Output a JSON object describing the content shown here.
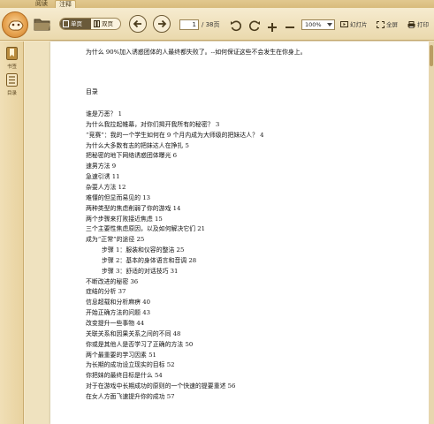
{
  "menu": {
    "tabs": [
      {
        "label": "阅读"
      },
      {
        "label": "注释"
      }
    ]
  },
  "toolbar": {
    "view_single": "单页",
    "view_double": "双页",
    "page_current": "1",
    "page_total": "/ 38页",
    "zoom": "100%",
    "slideshow": "幻灯片",
    "fullscreen": "全屏",
    "print": "打印"
  },
  "sidebar": {
    "items": [
      {
        "label": "书签"
      },
      {
        "label": "目录"
      }
    ]
  },
  "document": {
    "intro": "为什么 90%加入诱惑团体的人最终都失败了。--如何保证这些不会发生在你身上。",
    "toc_title": "目录",
    "toc": [
      {
        "text": "谁是万恶？   1",
        "indent": false
      },
      {
        "text": "为什么我拉起帷幕，对你们揭开我所有的秘密？   3",
        "indent": false
      },
      {
        "text": "“竞赛”：我的一个学生如何在 9 个月内成为大师级的把妹达人？   4",
        "indent": false
      },
      {
        "text": "为什么大多数有志的把妹达人在挣扎   5",
        "indent": false
      },
      {
        "text": "把秘密的地下网络诱惑团体曝光   6",
        "indent": false
      },
      {
        "text": "速男方法   9",
        "indent": false
      },
      {
        "text": "急速引诱   11",
        "indent": false
      },
      {
        "text": "杂耍人方法   12",
        "indent": false
      },
      {
        "text": "难懂的但显而易见的   13",
        "indent": false
      },
      {
        "text": "两种类型的焦虑削弱了你的游戏   14",
        "indent": false
      },
      {
        "text": "两个步骤来打败接近焦虑   15",
        "indent": false
      },
      {
        "text": "三个主要性焦虑原因，以及如何解决它们   21",
        "indent": false
      },
      {
        "text": "成为“正常”的途径   25",
        "indent": false
      },
      {
        "text": "步骤 1：服装和仪容的整洁   25",
        "indent": true
      },
      {
        "text": "步骤 2：基本的身体语言和音调   28",
        "indent": true
      },
      {
        "text": "步骤 3：舒适的对话技巧   31",
        "indent": true
      },
      {
        "text": "不断改进的秘密   36",
        "indent": false
      },
      {
        "text": "症结的分析   37",
        "indent": false
      },
      {
        "text": "信息超载和分析麻痹   40",
        "indent": false
      },
      {
        "text": "开始正确方法的问题   43",
        "indent": false
      },
      {
        "text": "改变提升一些事物   44",
        "indent": false
      },
      {
        "text": "关联关系和因果关系之间的不同   48",
        "indent": false
      },
      {
        "text": "你或是其他人是否学习了正确的方法   50",
        "indent": false
      },
      {
        "text": "两个最重要的学习因素   51",
        "indent": false
      },
      {
        "text": "为长期的成功设立现实的目标   52",
        "indent": false
      },
      {
        "text": "你把妹的最终目标是什么   54",
        "indent": false
      },
      {
        "text": "对于在游戏中长期成功的原则的一个快速的提要重述   56",
        "indent": false
      },
      {
        "text": "在女人方面飞速提升你的成功   57",
        "indent": false
      }
    ]
  }
}
